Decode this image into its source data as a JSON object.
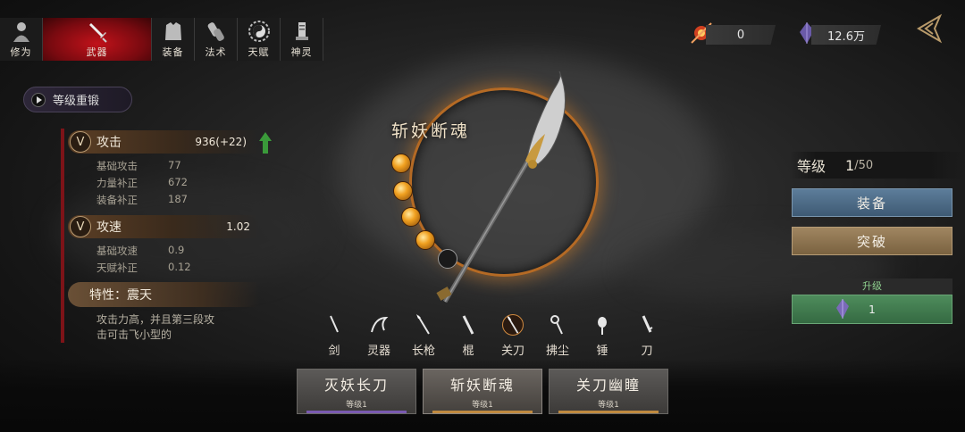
{
  "tabs": [
    {
      "label": "修为",
      "icon": "cultivator-icon",
      "active": false
    },
    {
      "label": "武器",
      "icon": "sword-icon",
      "active": true
    },
    {
      "label": "装备",
      "icon": "armor-icon",
      "active": false
    },
    {
      "label": "法术",
      "icon": "spell-icon",
      "active": false
    },
    {
      "label": "天赋",
      "icon": "yinyang-icon",
      "active": false
    },
    {
      "label": "神灵",
      "icon": "shrine-icon",
      "active": false
    }
  ],
  "currency": [
    {
      "icon": "spirit-orb-icon",
      "value": "0"
    },
    {
      "icon": "crystal-icon",
      "value": "12.6万"
    }
  ],
  "reset_label": "等级重锻",
  "stats": {
    "attack": {
      "label": "攻击",
      "value": "936(+22)",
      "rows": [
        {
          "k": "基础攻击",
          "v": "77"
        },
        {
          "k": "力量补正",
          "v": "672"
        },
        {
          "k": "装备补正",
          "v": "187"
        }
      ]
    },
    "speed": {
      "label": "攻速",
      "value": "1.02",
      "rows": [
        {
          "k": "基础攻速",
          "v": "0.9"
        },
        {
          "k": "天赋补正",
          "v": "0.12"
        }
      ]
    },
    "trait": "特性：震天",
    "description": "攻击力高，并且第三段攻击可击飞小型的"
  },
  "weapon": {
    "name": "斩妖断魂",
    "orbs_filled": 4,
    "orbs_total": 5
  },
  "weapon_types": [
    {
      "label": "剑",
      "icon": "sword-type-icon"
    },
    {
      "label": "灵器",
      "icon": "dragon-artifact-icon"
    },
    {
      "label": "长枪",
      "icon": "spear-icon"
    },
    {
      "label": "棍",
      "icon": "staff-icon"
    },
    {
      "label": "关刀",
      "icon": "guandao-icon",
      "selected": true
    },
    {
      "label": "拂尘",
      "icon": "whisk-icon"
    },
    {
      "label": "锤",
      "icon": "hammer-icon"
    },
    {
      "label": "刀",
      "icon": "blade-icon"
    }
  ],
  "weapon_cards": [
    {
      "name": "灭妖长刀",
      "level": "等级1",
      "accent": "#7a5ab0"
    },
    {
      "name": "斩妖断魂",
      "level": "等级1",
      "accent": "#c08a40",
      "selected": true
    },
    {
      "name": "关刀幽瞳",
      "level": "等级1",
      "accent": "#c08a40"
    }
  ],
  "level": {
    "label": "等级",
    "current": "1",
    "max": "/50"
  },
  "equip_label": "装备",
  "breakthrough_label": "突破",
  "upgrade": {
    "header": "升级",
    "cost": "1"
  },
  "colors": {
    "active_tab": "#c1121a",
    "ring": "#b56a24",
    "equip": "#5d7d9a",
    "break": "#a08661",
    "upgrade": "#4e8c5c"
  }
}
